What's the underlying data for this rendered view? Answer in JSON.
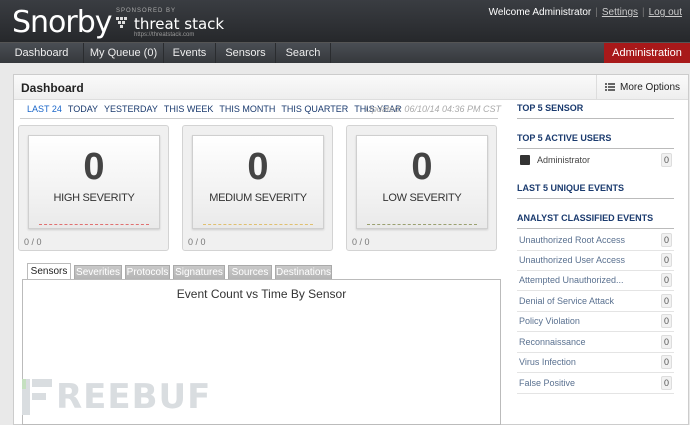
{
  "header": {
    "logo": "Snorby",
    "sponsor_label": "SPONSORED BY",
    "sponsor_name": "threat stack",
    "sponsor_url": "https://threatstack.com",
    "welcome": "Welcome Administrator",
    "settings": "Settings",
    "logout": "Log out",
    "separator": "|"
  },
  "nav": {
    "items": [
      "Dashboard",
      "My Queue (0)",
      "Events",
      "Sensors",
      "Search"
    ],
    "admin": "Administration"
  },
  "dashboard": {
    "title": "Dashboard",
    "more_options": "More Options",
    "ranges": [
      "LAST 24",
      "TODAY",
      "YESTERDAY",
      "THIS WEEK",
      "THIS MONTH",
      "THIS QUARTER",
      "THIS YEAR"
    ],
    "active_range": "LAST 24",
    "updated": "Updated: 06/10/14 04:36 PM CST"
  },
  "severity": [
    {
      "count": "0",
      "label": "HIGH SEVERITY",
      "ratio": "0 / 0",
      "color": "#e07070"
    },
    {
      "count": "0",
      "label": "MEDIUM SEVERITY",
      "ratio": "0 / 0",
      "color": "#e0c070"
    },
    {
      "count": "0",
      "label": "LOW SEVERITY",
      "ratio": "0 / 0",
      "color": "#9aa070"
    }
  ],
  "tabs": {
    "items": [
      "Sensors",
      "Severities",
      "Protocols",
      "Signatures",
      "Sources",
      "Destinations"
    ],
    "active": "Sensors"
  },
  "chart": {
    "title": "Event Count vs Time By Sensor"
  },
  "sidebar": {
    "top_sensor": "TOP 5 SENSOR",
    "top_users": "TOP 5 ACTIVE USERS",
    "users": [
      {
        "name": "Administrator",
        "count": "0"
      }
    ],
    "unique_events": "LAST 5 UNIQUE EVENTS",
    "classified": "ANALYST CLASSIFIED EVENTS",
    "classifications": [
      {
        "label": "Unauthorized Root Access",
        "count": "0"
      },
      {
        "label": "Unauthorized User Access",
        "count": "0"
      },
      {
        "label": "Attempted Unauthorized...",
        "count": "0"
      },
      {
        "label": "Denial of Service Attack",
        "count": "0"
      },
      {
        "label": "Policy Violation",
        "count": "0"
      },
      {
        "label": "Reconnaissance",
        "count": "0"
      },
      {
        "label": "Virus Infection",
        "count": "0"
      },
      {
        "label": "False Positive",
        "count": "0"
      }
    ]
  },
  "watermark": "REEBUF"
}
